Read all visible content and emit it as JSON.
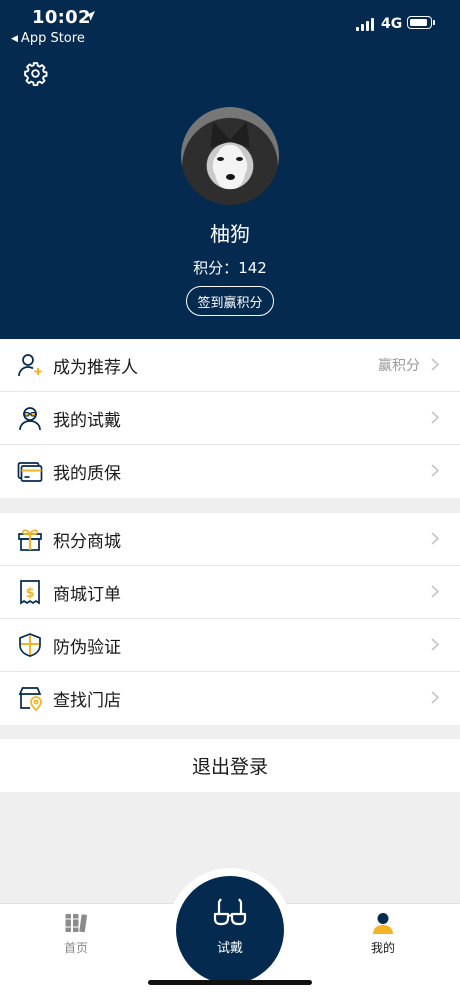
{
  "status_bar": {
    "time": "10:02",
    "back_app": "App Store",
    "network": "4G"
  },
  "profile": {
    "name": "柚狗",
    "points_label": "积分：",
    "points_value": "142",
    "checkin_button": "签到赢积分"
  },
  "menu_group_1": [
    {
      "label": "成为推荐人",
      "hint": "赢积分",
      "icon": "referrer-icon"
    },
    {
      "label": "我的试戴",
      "hint": "",
      "icon": "try-on-icon"
    },
    {
      "label": "我的质保",
      "hint": "",
      "icon": "warranty-card-icon"
    }
  ],
  "menu_group_2": [
    {
      "label": "积分商城",
      "icon": "gift-icon"
    },
    {
      "label": "商城订单",
      "icon": "order-receipt-icon"
    },
    {
      "label": "防伪验证",
      "icon": "shield-icon"
    },
    {
      "label": "查找门店",
      "icon": "store-location-icon"
    }
  ],
  "logout_label": "退出登录",
  "tabbar": {
    "home": "首页",
    "try_on": "试戴",
    "mine": "我的"
  },
  "colors": {
    "brand_navy": "#042a4f",
    "accent_yellow": "#f5b423",
    "background": "#efefef"
  }
}
